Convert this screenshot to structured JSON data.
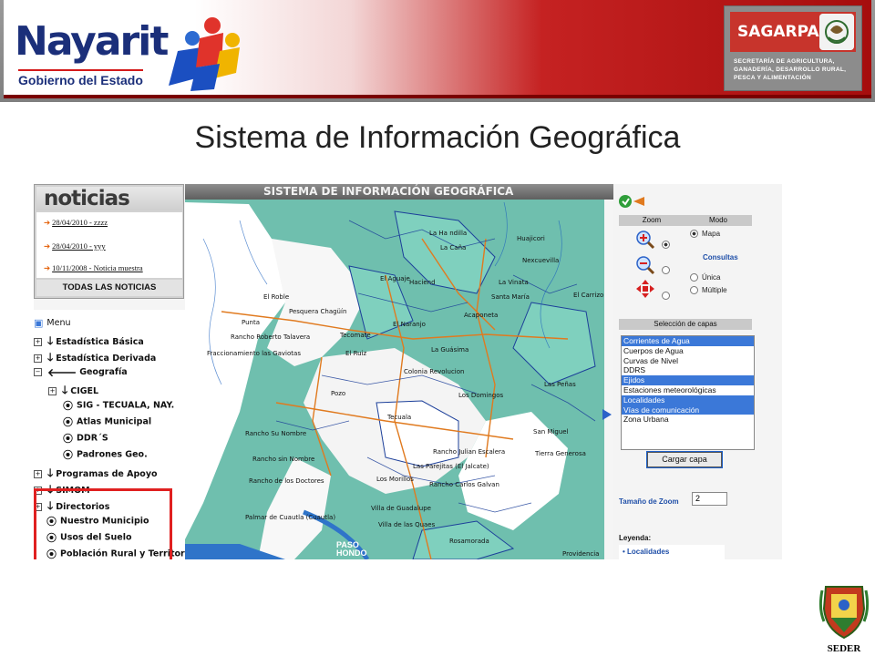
{
  "header": {
    "nayarit_logo_text": "Nayarit",
    "nayarit_subtitle": "Gobierno del Estado",
    "sagarpa_name": "SAGARPA",
    "sagarpa_desc": "SECRETARÍA DE AGRICULTURA, GANADERÍA, DESARROLLO RURAL, PESCA Y ALIMENTACIÓN"
  },
  "slide_title": "Sistema de Información Geográfica",
  "noticias": {
    "heading": "noticias",
    "items": [
      "28/04/2010 - zzzz",
      "28/04/2010 - yyy",
      "10/11/2008 - Noticia muestra"
    ],
    "all_link": "TODAS LAS NOTICIAS"
  },
  "menu": {
    "title": "Menu",
    "items": [
      "Estadística Básica",
      "Estadística Derivada",
      "Geografía",
      "CIGEL",
      "SIG - TECUALA, NAY.",
      "Atlas Municipal",
      "DDR´S",
      "Padrones Geo.",
      "Programas de Apoyo",
      "SIMOM",
      "Directorios",
      "Nuestro Municipio",
      "Usos del Suelo",
      "Población Rural y Territorio"
    ]
  },
  "map": {
    "header": "SISTEMA DE INFORMACIÓN GEOGRÁFICA",
    "labels": [
      "Huajicori",
      "La Ha ndilla",
      "La Caña",
      "El Aguaje",
      "Haciend",
      "Acaponeta",
      "Tecuala",
      "El Roble",
      "Pesquera Chagüín",
      "Punta",
      "Tecomate",
      "Colonia Revolucion",
      "Rancho Roberto Talavera",
      "Fraccionamiento las Gaviotas",
      "Rancho Su Nombre",
      "Rancho sin Nombre",
      "Rancho de los Doctores",
      "Palmar de Cuautla (Cuautla)",
      "Rosamorada",
      "Los Morillos",
      "Villa de Guadalupe",
      "Villa de las Quaes",
      "San Miguel",
      "Tierra Generosa",
      "Providencia",
      "El Carrizo",
      "El Naranjo",
      "La Guásima",
      "Las Parejitas (El Jalcate)",
      "Rancho Carlos Galvan",
      "Rancho Julian Escalera",
      "Nexcuevilla",
      "La Vinata",
      "Santa María",
      "Las Peñas",
      "Pozo",
      "Los Domingos",
      "El Ruiz"
    ],
    "paso_hondo": "PASO\nHONDO"
  },
  "right_panel": {
    "zoom_header": "Zoom",
    "modo_header": "Modo",
    "mapa": "Mapa",
    "consultas": "Consultas",
    "unica": "Única",
    "multiple": "Múltiple",
    "capas_header": "Selección de capas",
    "layers": [
      {
        "name": "Corrientes de Agua",
        "selected": true
      },
      {
        "name": "Cuerpos de Agua",
        "selected": false
      },
      {
        "name": "Curvas de Nivel",
        "selected": false
      },
      {
        "name": "DDRS",
        "selected": false
      },
      {
        "name": "Ejidos",
        "selected": true
      },
      {
        "name": "Estaciones meteorológicas",
        "selected": false
      },
      {
        "name": "Localidades",
        "selected": true
      },
      {
        "name": "Vías de comunicación",
        "selected": true
      },
      {
        "name": "Zona Urbana",
        "selected": false
      }
    ],
    "cargar_btn": "Cargar capa",
    "tam_zoom_label": "Tamaño de Zoom",
    "tam_zoom_value": "2",
    "leyenda_label": "Leyenda:",
    "leyenda_item": "Localidades"
  },
  "footer": {
    "seder": "SEDER"
  },
  "colors": {
    "accent_red": "#c52222",
    "map_teal": "#6fbfae",
    "selection_blue": "#3b78d8"
  }
}
